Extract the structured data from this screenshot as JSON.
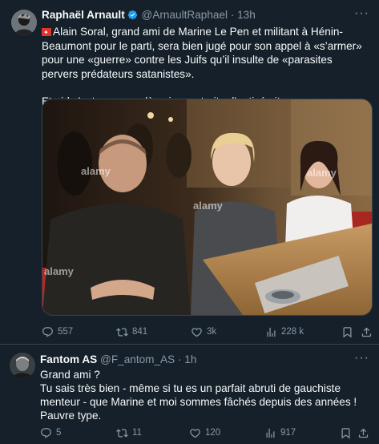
{
  "tweet1": {
    "name": "Raphaël Arnault",
    "handle": "@ArnaultRaphael",
    "time": "13h",
    "paragraph1": "Alain Soral, grand ami de Marine Le Pen et militant à Hénin-Beaumont pour le parti, sera bien jugé pour son appel à «s’armer» pour une «guerre» contre les Juifs qu’il insulte de «parasites pervers prédateurs satanistes».",
    "paragraph2": "Et ajd c’est ces gens-là qui nous traite d’antisémites…",
    "watermark": "alamy",
    "stats": {
      "replies": "557",
      "retweets": "841",
      "likes": "3k",
      "views": "228 k"
    }
  },
  "tweet2": {
    "name": "Fantom AS",
    "handle": "@F_antom_AS",
    "time": "1h",
    "lines": [
      "Grand ami ?",
      "Tu sais très bien - même si tu es un parfait abruti de gauchiste menteur - que Marine et moi sommes fâchés depuis des années !",
      "Pauvre type."
    ],
    "stats": {
      "replies": "5",
      "retweets": "11",
      "likes": "120",
      "views": "917"
    }
  },
  "colors": {
    "background": "#15202b",
    "text": "#f7f9f9",
    "muted": "#8b98a5",
    "divider": "#38444d",
    "verified": "#1d9bf0"
  }
}
